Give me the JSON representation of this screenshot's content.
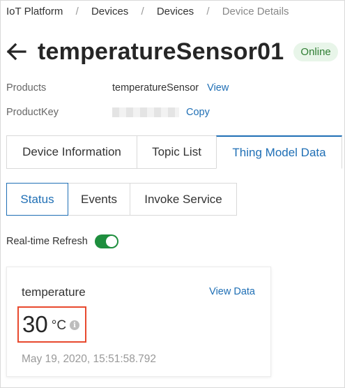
{
  "breadcrumb": [
    "IoT Platform",
    "Devices",
    "Devices",
    "Device Details"
  ],
  "breadcrumb_separator": "/",
  "title": "temperatureSensor01",
  "status_badge": "Online",
  "products": {
    "label": "Products",
    "value": "temperatureSensor",
    "link": "View"
  },
  "product_key": {
    "label": "ProductKey",
    "value_masked": true,
    "link": "Copy"
  },
  "tabs": [
    {
      "label": "Device Information",
      "active": false
    },
    {
      "label": "Topic List",
      "active": false
    },
    {
      "label": "Thing Model Data",
      "active": true
    }
  ],
  "subtabs": [
    {
      "label": "Status",
      "active": true
    },
    {
      "label": "Events",
      "active": false
    },
    {
      "label": "Invoke Service",
      "active": false
    }
  ],
  "realtime_refresh": {
    "label": "Real-time Refresh",
    "enabled": true
  },
  "property_card": {
    "title": "temperature",
    "link": "View Data",
    "value": "30",
    "unit": "°C",
    "timestamp": "May 19, 2020, 15:51:58.792"
  },
  "colors": {
    "accent": "#1f6fb5",
    "online_bg": "#e8f5e9",
    "online_text": "#2e7d32",
    "toggle_on": "#1e8e3e",
    "highlight_border": "#e8492e"
  },
  "icons": [
    "back-arrow-icon",
    "info-icon"
  ]
}
